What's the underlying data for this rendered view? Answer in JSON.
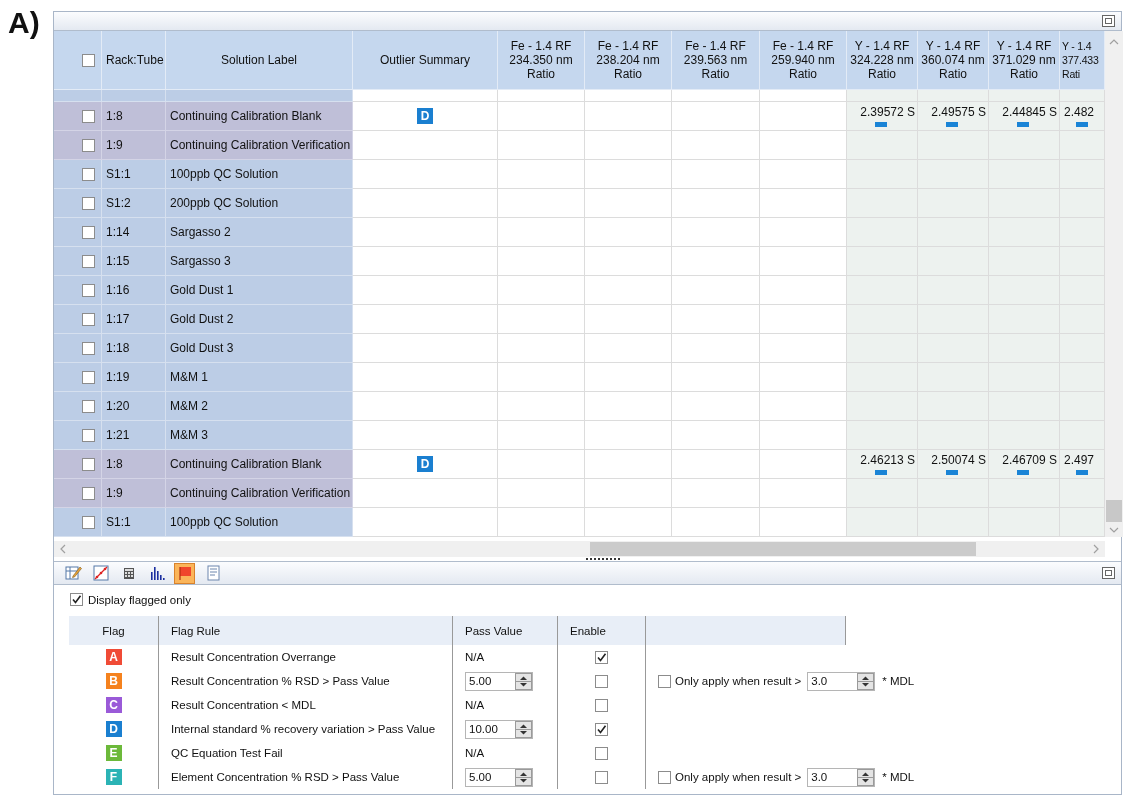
{
  "figure_label": "A)",
  "results_table": {
    "select_all_checked": false,
    "columns": [
      {
        "kind": "rack",
        "label": "Rack:Tube"
      },
      {
        "kind": "label",
        "label": "Solution Label"
      },
      {
        "kind": "outlier",
        "label": "Outlier Summary"
      },
      {
        "kind": "fe",
        "label": "Fe - 1.4 RF\n234.350 nm\nRatio"
      },
      {
        "kind": "fe",
        "label": "Fe - 1.4 RF\n238.204 nm\nRatio"
      },
      {
        "kind": "fe",
        "label": "Fe - 1.4 RF\n239.563 nm\nRatio"
      },
      {
        "kind": "fe",
        "label": "Fe - 1.4 RF\n259.940 nm\nRatio"
      },
      {
        "kind": "y",
        "label": "Y - 1.4 RF\n324.228 nm\nRatio"
      },
      {
        "kind": "y",
        "label": "Y - 1.4 RF\n360.074 nm\nRatio"
      },
      {
        "kind": "y",
        "label": "Y - 1.4 RF\n371.029 nm\nRatio"
      },
      {
        "kind": "y",
        "label": "Y - 1.4\n377.433\nRati"
      }
    ],
    "rows": [
      {
        "rack_tube": "1:8",
        "solution_label": "Continuing Calibration Blank",
        "checked": false,
        "kind": "check_standard",
        "outlier_flag": {
          "text": "D",
          "color": "#1a7fd0"
        },
        "y_values": [
          {
            "text": "2.39572 S",
            "flag_mark": true
          },
          {
            "text": "2.49575 S",
            "flag_mark": true
          },
          {
            "text": "2.44845 S",
            "flag_mark": true
          },
          {
            "text": "2.482",
            "flag_mark": true
          }
        ]
      },
      {
        "rack_tube": "1:9",
        "solution_label": "Continuing Calibration Verification",
        "checked": false,
        "kind": "check_standard"
      },
      {
        "rack_tube": "S1:1",
        "solution_label": "100ppb QC Solution",
        "checked": false,
        "kind": "sample"
      },
      {
        "rack_tube": "S1:2",
        "solution_label": "200ppb QC Solution",
        "checked": false,
        "kind": "sample"
      },
      {
        "rack_tube": "1:14",
        "solution_label": "Sargasso 2",
        "checked": false,
        "kind": "sample"
      },
      {
        "rack_tube": "1:15",
        "solution_label": "Sargasso 3",
        "checked": false,
        "kind": "sample"
      },
      {
        "rack_tube": "1:16",
        "solution_label": "Gold Dust 1",
        "checked": false,
        "kind": "sample"
      },
      {
        "rack_tube": "1:17",
        "solution_label": "Gold Dust 2",
        "checked": false,
        "kind": "sample"
      },
      {
        "rack_tube": "1:18",
        "solution_label": "Gold Dust 3",
        "checked": false,
        "kind": "sample"
      },
      {
        "rack_tube": "1:19",
        "solution_label": "M&M 1",
        "checked": false,
        "kind": "sample"
      },
      {
        "rack_tube": "1:20",
        "solution_label": "M&M 2",
        "checked": false,
        "kind": "sample"
      },
      {
        "rack_tube": "1:21",
        "solution_label": "M&M 3",
        "checked": false,
        "kind": "sample"
      },
      {
        "rack_tube": "1:8",
        "solution_label": "Continuing Calibration Blank",
        "checked": false,
        "kind": "check_standard",
        "outlier_flag": {
          "text": "D",
          "color": "#1a7fd0"
        },
        "y_values": [
          {
            "text": "2.46213 S",
            "flag_mark": true
          },
          {
            "text": "2.50074 S",
            "flag_mark": true
          },
          {
            "text": "2.46709 S",
            "flag_mark": true
          },
          {
            "text": "2.497",
            "flag_mark": true
          }
        ]
      },
      {
        "rack_tube": "1:9",
        "solution_label": "Continuing Calibration Verification",
        "checked": false,
        "kind": "check_standard"
      },
      {
        "rack_tube": "S1:1",
        "solution_label": "100ppb QC Solution",
        "checked": false,
        "kind": "sample"
      }
    ]
  },
  "toolbar": [
    {
      "kind": "edit",
      "selected": false
    },
    {
      "kind": "graph",
      "selected": false
    },
    {
      "kind": "grid",
      "selected": false
    },
    {
      "kind": "histogram",
      "selected": false
    },
    {
      "kind": "flag",
      "selected": true
    },
    {
      "kind": "report",
      "selected": false
    }
  ],
  "display_flagged_only": {
    "label": "Display flagged only",
    "checked": true
  },
  "flag_rules": {
    "columns": [
      "Flag",
      "Flag Rule",
      "Pass Value",
      "Enable"
    ],
    "rows": [
      {
        "flag": "A",
        "color": "#f04b36",
        "rule": "Result Concentration Overrange",
        "kind": "text",
        "pass_value": "N/A",
        "enabled": true
      },
      {
        "flag": "B",
        "color": "#f5821e",
        "rule": "Result Concentration % RSD  > Pass Value",
        "kind": "spin",
        "pass_value": "5.00",
        "enabled": false,
        "mdl_option": {
          "checked": false,
          "label": "Only apply when result >",
          "value": "3.0",
          "suffix": "* MDL"
        }
      },
      {
        "flag": "C",
        "color": "#9a5ad8",
        "rule": "Result Concentration < MDL",
        "kind": "text",
        "pass_value": "N/A",
        "enabled": false
      },
      {
        "flag": "D",
        "color": "#1a7fd0",
        "rule": "Internal standard % recovery variation > Pass Value",
        "kind": "spin",
        "pass_value": "10.00",
        "enabled": true
      },
      {
        "flag": "E",
        "color": "#6cb93a",
        "rule": "QC Equation Test Fail",
        "kind": "text",
        "pass_value": "N/A",
        "enabled": false
      },
      {
        "flag": "F",
        "color": "#2bb3b5",
        "rule": "Element Concentration % RSD  > Pass Value",
        "kind": "spin",
        "pass_value": "5.00",
        "enabled": false,
        "mdl_option": {
          "checked": false,
          "label": "Only apply when result >",
          "value": "3.0",
          "suffix": "* MDL"
        }
      }
    ]
  }
}
